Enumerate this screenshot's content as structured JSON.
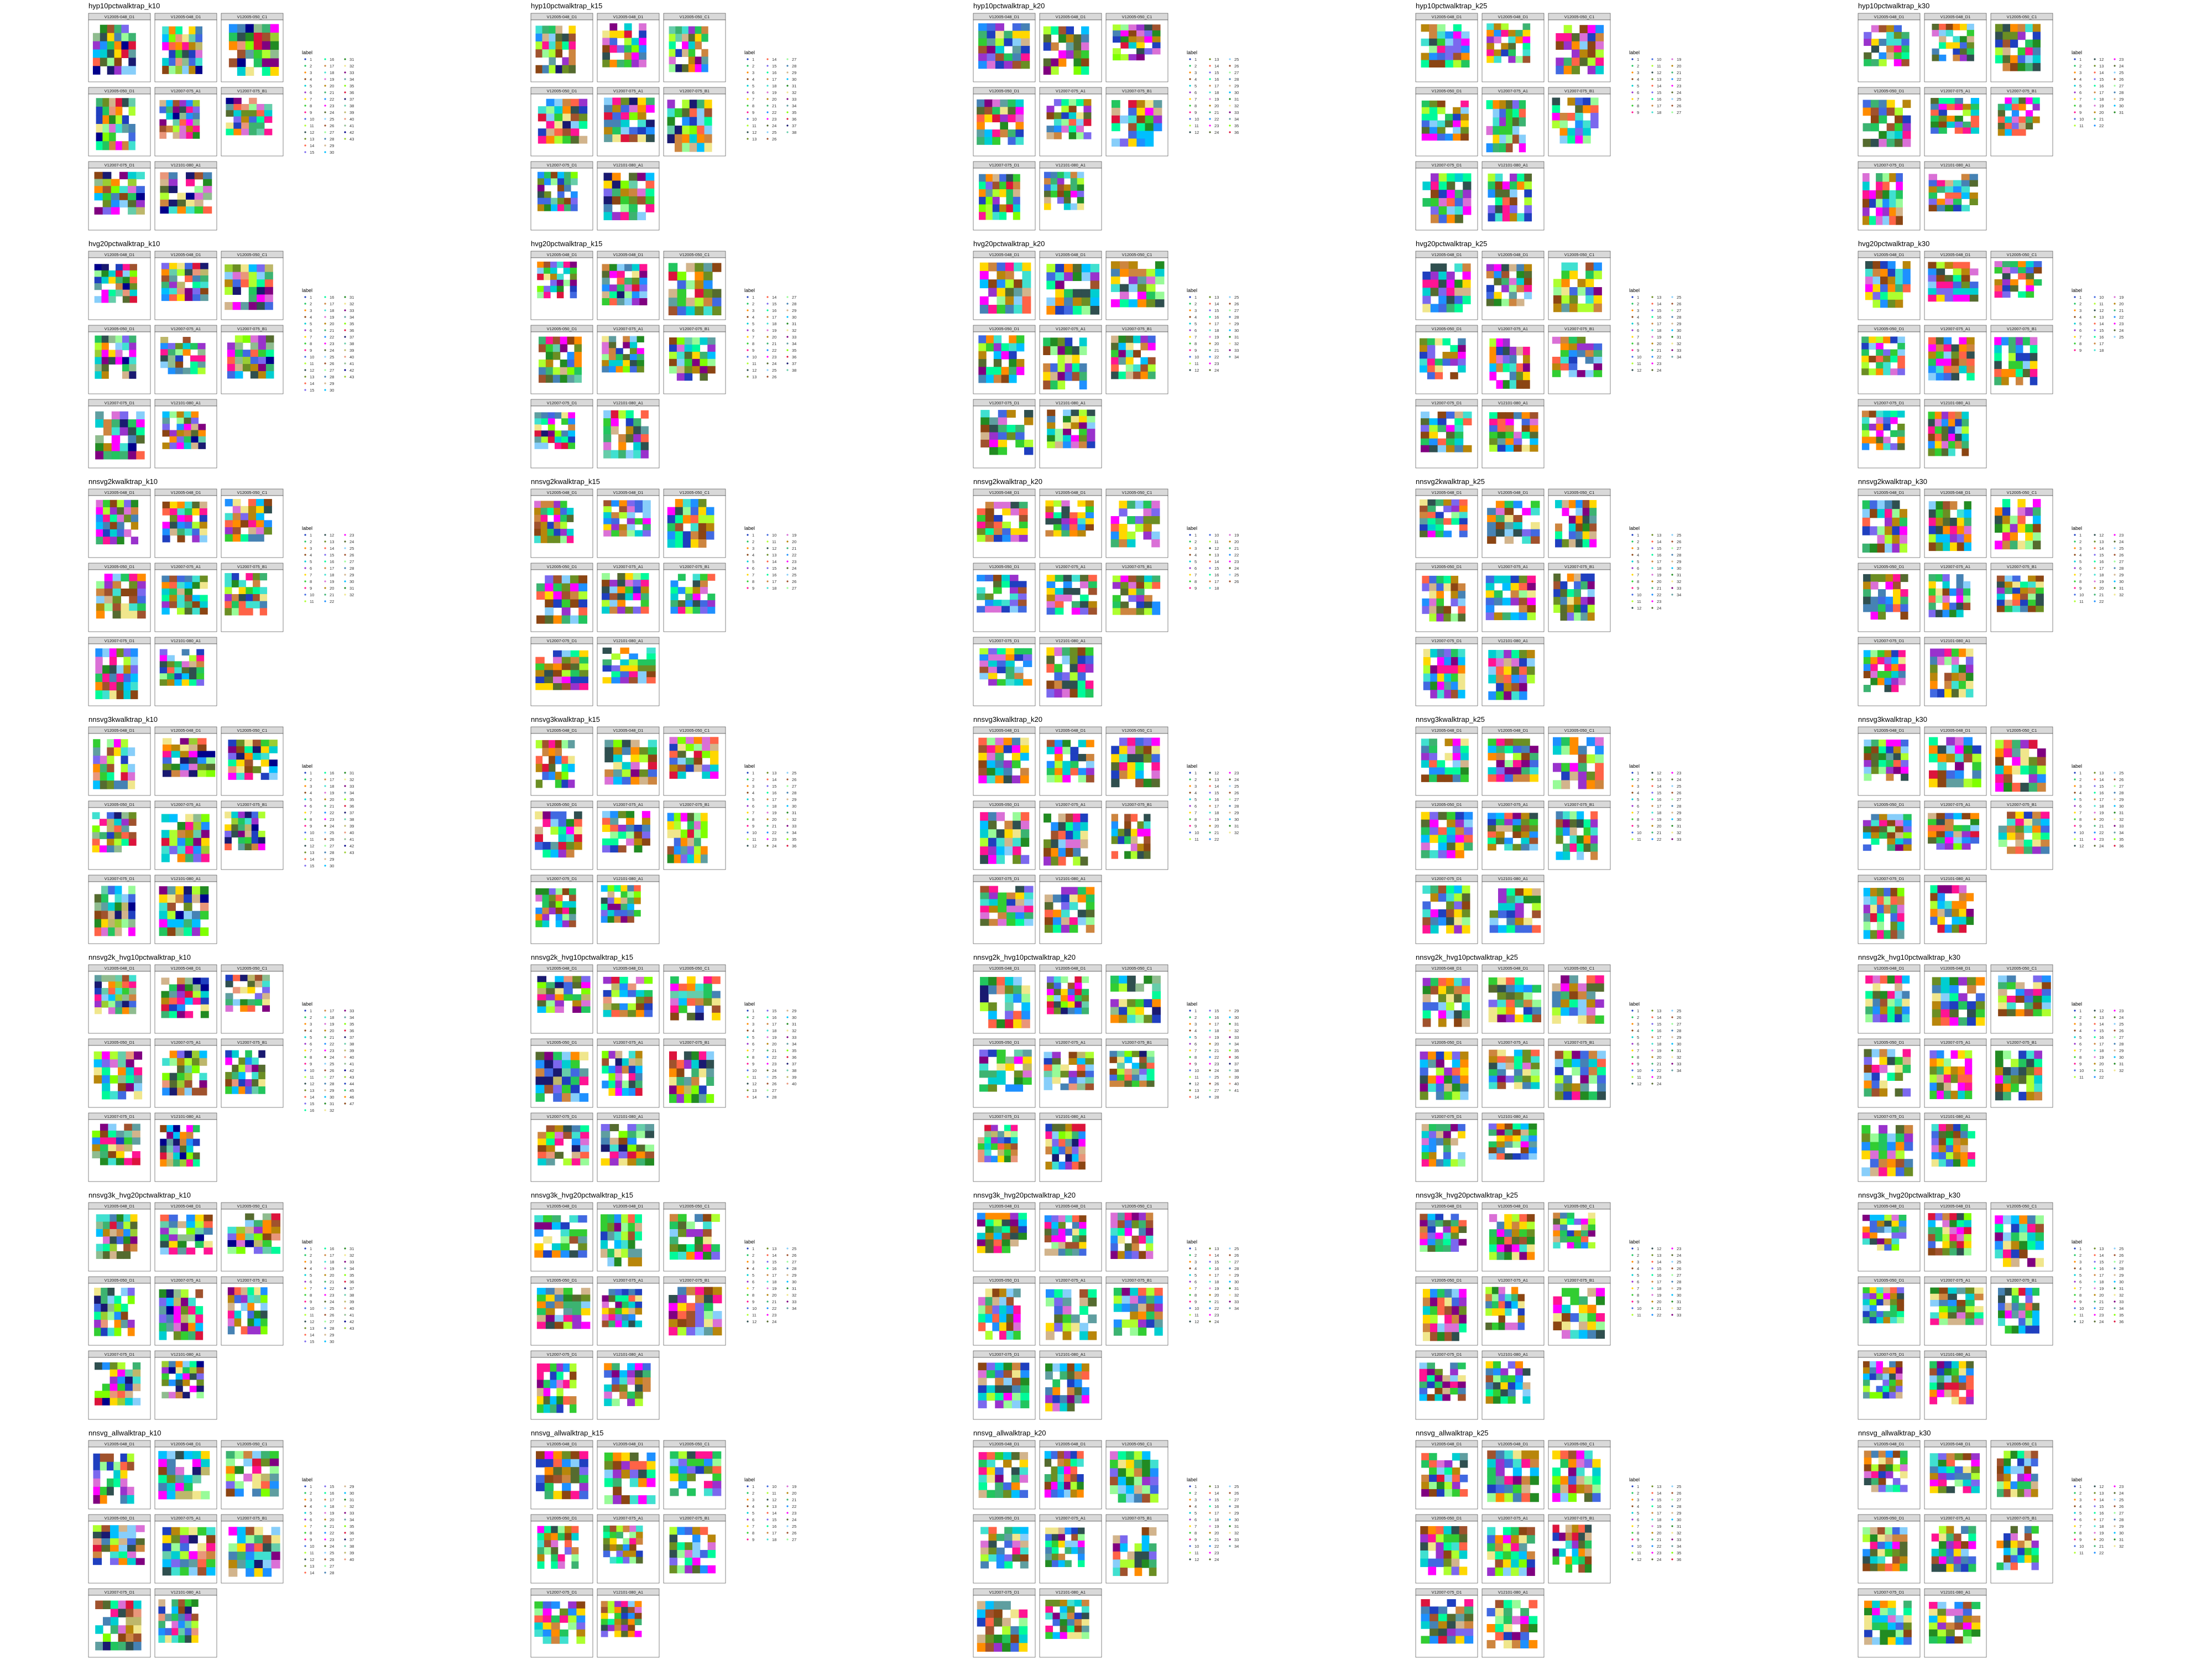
{
  "page": {
    "background": "#ffffff"
  },
  "samples": [
    "V12005-048_D1",
    "V12005-048_D1",
    "V12005-050_C1",
    "V12005-050_D1",
    "V12007-075_A1",
    "V12007-075_B1",
    "V12007-075_D1",
    "V12101-080_A1"
  ],
  "legend_title": "label",
  "palette": [
    "#1f3fbf",
    "#22c55e",
    "#ff8c00",
    "#8b4513",
    "#00ced1",
    "#9932cc",
    "#ffd700",
    "#32cd32",
    "#ff1493",
    "#4169e1",
    "#adff2f",
    "#2f4f4f",
    "#6b8e23",
    "#ff6347",
    "#7b68ee",
    "#00fa9a",
    "#cd853f",
    "#40e0d0",
    "#da70d6",
    "#b8860b",
    "#3cb371",
    "#1e90ff",
    "#ff00ff",
    "#556b2f",
    "#87cefa",
    "#a0522d",
    "#98fb98",
    "#4682b4",
    "#d2b48c",
    "#00bfff",
    "#228b22",
    "#f0e68c",
    "#800080",
    "#5f9ea0",
    "#7fff00",
    "#dc143c",
    "#191970",
    "#66cdaa",
    "#bdb76b",
    "#e9967a",
    "#8fbc8f",
    "#00008b",
    "#9acd32"
  ],
  "chart_data": [
    {
      "type": "scatter",
      "title": "hyp10pctwalktrap_k10",
      "legend_title": "label",
      "n_clusters": 43
    },
    {
      "type": "scatter",
      "title": "hyp10pctwalktrap_k15",
      "legend_title": "label",
      "n_clusters": 38
    },
    {
      "type": "scatter",
      "title": "hyp10pctwalktrap_k20",
      "legend_title": "label",
      "n_clusters": 36
    },
    {
      "type": "scatter",
      "title": "hyp10pctwalktrap_k25",
      "legend_title": "label",
      "n_clusters": 27
    },
    {
      "type": "scatter",
      "title": "hyp10pctwalktrap_k30",
      "legend_title": "label",
      "n_clusters": 31
    },
    {
      "type": "scatter",
      "title": "hvg20pctwalktrap_k10",
      "legend_title": "label",
      "n_clusters": 43
    },
    {
      "type": "scatter",
      "title": "hvg20pctwalktrap_k15",
      "legend_title": "label",
      "n_clusters": 38
    },
    {
      "type": "scatter",
      "title": "hvg20pctwalktrap_k20",
      "legend_title": "label",
      "n_clusters": 34
    },
    {
      "type": "scatter",
      "title": "hvg20pctwalktrap_k25",
      "legend_title": "label",
      "n_clusters": 34
    },
    {
      "type": "scatter",
      "title": "hvg20pctwalktrap_k30",
      "legend_title": "label",
      "n_clusters": 25
    },
    {
      "type": "scatter",
      "title": "nnsvg2kwalktrap_k10",
      "legend_title": "label",
      "n_clusters": 32
    },
    {
      "type": "scatter",
      "title": "nnsvg2kwalktrap_k15",
      "legend_title": "label",
      "n_clusters": 27
    },
    {
      "type": "scatter",
      "title": "nnsvg2kwalktrap_k20",
      "legend_title": "label",
      "n_clusters": 26
    },
    {
      "type": "scatter",
      "title": "nnsvg2kwalktrap_k25",
      "legend_title": "label",
      "n_clusters": 34
    },
    {
      "type": "scatter",
      "title": "nnsvg2kwalktrap_k30",
      "legend_title": "label",
      "n_clusters": 32
    },
    {
      "type": "scatter",
      "title": "nnsvg3kwalktrap_k10",
      "legend_title": "label",
      "n_clusters": 43
    },
    {
      "type": "scatter",
      "title": "nnsvg3kwalktrap_k15",
      "legend_title": "label",
      "n_clusters": 36
    },
    {
      "type": "scatter",
      "title": "nnsvg3kwalktrap_k20",
      "legend_title": "label",
      "n_clusters": 32
    },
    {
      "type": "scatter",
      "title": "nnsvg3kwalktrap_k25",
      "legend_title": "label",
      "n_clusters": 33
    },
    {
      "type": "scatter",
      "title": "nnsvg3kwalktrap_k30",
      "legend_title": "label",
      "n_clusters": 36
    },
    {
      "type": "scatter",
      "title": "nnsvg2k_hvg10pctwalktrap_k10",
      "legend_title": "label",
      "n_clusters": 47
    },
    {
      "type": "scatter",
      "title": "nnsvg2k_hvg10pctwalktrap_k15",
      "legend_title": "label",
      "n_clusters": 40
    },
    {
      "type": "scatter",
      "title": "nnsvg2k_hvg10pctwalktrap_k20",
      "legend_title": "label",
      "n_clusters": 41
    },
    {
      "type": "scatter",
      "title": "nnsvg2k_hvg10pctwalktrap_k25",
      "legend_title": "label",
      "n_clusters": 34
    },
    {
      "type": "scatter",
      "title": "nnsvg2k_hvg10pctwalktrap_k30",
      "legend_title": "label",
      "n_clusters": 32
    },
    {
      "type": "scatter",
      "title": "nnsvg3k_hvg20pctwalktrap_k10",
      "legend_title": "label",
      "n_clusters": 43
    },
    {
      "type": "scatter",
      "title": "nnsvg3k_hvg20pctwalktrap_k15",
      "legend_title": "label",
      "n_clusters": 34
    },
    {
      "type": "scatter",
      "title": "nnsvg3k_hvg20pctwalktrap_k20",
      "legend_title": "label",
      "n_clusters": 34
    },
    {
      "type": "scatter",
      "title": "nnsvg3k_hvg20pctwalktrap_k25",
      "legend_title": "label",
      "n_clusters": 33
    },
    {
      "type": "scatter",
      "title": "nnsvg3k_hvg20pctwalktrap_k30",
      "legend_title": "label",
      "n_clusters": 36
    },
    {
      "type": "scatter",
      "title": "nnsvg_allwalktrap_k10",
      "legend_title": "label",
      "n_clusters": 40
    },
    {
      "type": "scatter",
      "title": "nnsvg_allwalktrap_k15",
      "legend_title": "label",
      "n_clusters": 27
    },
    {
      "type": "scatter",
      "title": "nnsvg_allwalktrap_k20",
      "legend_title": "label",
      "n_clusters": 34
    },
    {
      "type": "scatter",
      "title": "nnsvg_allwalktrap_k25",
      "legend_title": "label",
      "n_clusters": 36
    },
    {
      "type": "scatter",
      "title": "nnsvg_allwalktrap_k30",
      "legend_title": "label",
      "n_clusters": 32
    }
  ]
}
